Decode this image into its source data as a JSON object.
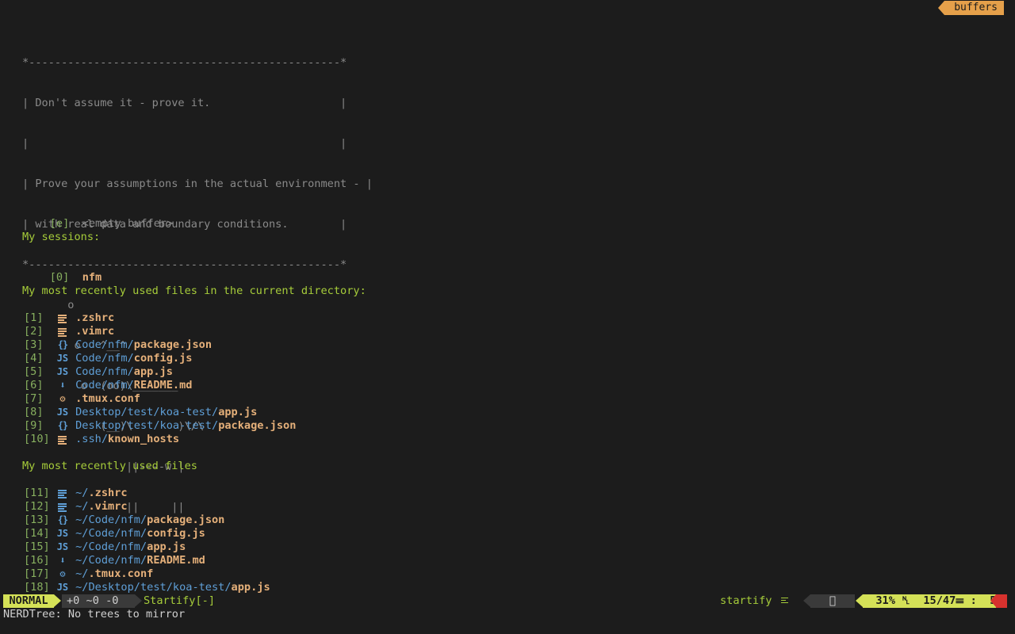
{
  "tabline": {
    "buffers_label": "buffers"
  },
  "cowsay": {
    "box_top": "*------------------------------------------------*",
    "box_lines": [
      "| Don't assume it - prove it.                    |",
      "|                                                |",
      "| Prove your assumptions in the actual environment - |",
      "| with real data and boundary conditions.        |"
    ],
    "box_bottom": "*------------------------------------------------*",
    "cow": [
      "       o",
      "        o   ^__^",
      "         o  (oo)\\_______",
      "            (__)\\       )\\/\\",
      "                ||----w |",
      "                ||     ||"
    ]
  },
  "empty_buffer": {
    "key": "[e]",
    "label": "<empty buffer>"
  },
  "sessions": {
    "heading": "My sessions:",
    "items": [
      {
        "key": "[0]",
        "name": "nfm"
      }
    ]
  },
  "dir_files": {
    "heading": "My most recently used files in the current directory:",
    "items": [
      {
        "key": "[1]",
        "icon": "text-file-icon",
        "dir": "",
        "file": ".zshrc"
      },
      {
        "key": "[2]",
        "icon": "text-file-icon",
        "dir": "",
        "file": ".vimrc"
      },
      {
        "key": "[3]",
        "icon": "json-icon",
        "glyph": "{}",
        "dir": "Code/nfm/",
        "file": "package.json"
      },
      {
        "key": "[4]",
        "icon": "javascript-icon",
        "glyph": "JS",
        "dir": "Code/nfm/",
        "file": "config.js"
      },
      {
        "key": "[5]",
        "icon": "javascript-icon",
        "glyph": "JS",
        "dir": "Code/nfm/",
        "file": "app.js"
      },
      {
        "key": "[6]",
        "icon": "markdown-icon",
        "glyph": "⬇",
        "dir": "Code/nfm/",
        "file": "README.md"
      },
      {
        "key": "[7]",
        "icon": "gear-icon",
        "glyph": "⚙",
        "dir": "",
        "file": ".tmux.conf"
      },
      {
        "key": "[8]",
        "icon": "javascript-icon",
        "glyph": "JS",
        "dir": "Desktop/test/koa-test/",
        "file": "app.js"
      },
      {
        "key": "[9]",
        "icon": "json-icon",
        "glyph": "{}",
        "dir": "Desktop/test/koa-test/",
        "file": "package.json"
      },
      {
        "key": "[10]",
        "icon": "text-file-icon",
        "dir": ".ssh/",
        "file": "known_hosts"
      }
    ]
  },
  "all_files": {
    "heading": "My most recently used files",
    "items": [
      {
        "key": "[11]",
        "icon": "text-file-icon",
        "dir": "~/",
        "file": ".zshrc"
      },
      {
        "key": "[12]",
        "icon": "text-file-icon",
        "dir": "~/",
        "file": ".vimrc"
      },
      {
        "key": "[13]",
        "icon": "json-icon",
        "glyph": "{}",
        "dir": "~/Code/nfm/",
        "file": "package.json"
      },
      {
        "key": "[14]",
        "icon": "javascript-icon",
        "glyph": "JS",
        "dir": "~/Code/nfm/",
        "file": "config.js"
      },
      {
        "key": "[15]",
        "icon": "javascript-icon",
        "glyph": "JS",
        "dir": "~/Code/nfm/",
        "file": "app.js"
      },
      {
        "key": "[16]",
        "icon": "markdown-icon",
        "glyph": "⬇",
        "dir": "~/Code/nfm/",
        "file": "README.md"
      },
      {
        "key": "[17]",
        "icon": "gear-icon",
        "glyph": "⚙",
        "dir": "~/",
        "file": ".tmux.conf"
      },
      {
        "key": "[18]",
        "icon": "javascript-icon",
        "glyph": "JS",
        "dir": "~/Desktop/test/koa-test/",
        "file": "app.js"
      }
    ]
  },
  "statusline": {
    "mode": "NORMAL",
    "diff": "+0 ~0 -0",
    "filename": "Startify[-]",
    "filetype": "startify",
    "percent": "31%",
    "position": "15/47",
    "column": "5"
  },
  "cmdline": "NERDTree: No trees to mirror",
  "colors": {
    "background": "#1c1c1c",
    "heading_green": "#a6cc3a",
    "file_orange": "#e5b07a",
    "dir_blue": "#5f9fd7",
    "mode_bg": "#d4e157",
    "tab_orange": "#e5a04a"
  }
}
